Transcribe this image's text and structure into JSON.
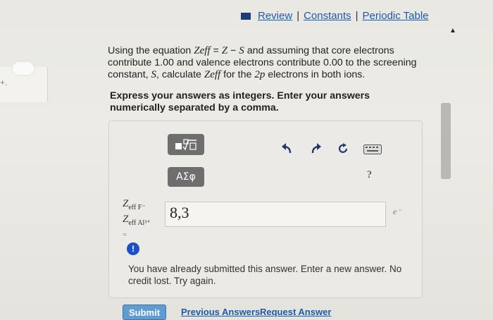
{
  "nav": {
    "review": "Review",
    "constants": "Constants",
    "periodic_table": "Periodic Table",
    "separator": "|"
  },
  "question": {
    "p1": "Using the equation ",
    "zeff": "Zeff",
    "eq": " = ",
    "z": "Z",
    "minus": " − ",
    "s": "S",
    "p2": " and assuming that core electrons contribute 1.00 and valence electrons contribute 0.00 to the screening constant, ",
    "s2": "S",
    "p3": ", calculate ",
    "zeff2": "Zeff",
    "p4": " for the ",
    "orbital": "2p",
    "p5": " electrons in both ions."
  },
  "instructions": "Express your answers as integers. Enter your answers numerically separated by a comma.",
  "toolbar": {
    "greek_label": "ΑΣφ",
    "help_label": "?"
  },
  "answer": {
    "label_line1": "Z",
    "label_sub1": "eff F⁻",
    "label_line2": "Z",
    "label_sub2": "eff Al³⁺",
    "label_eq": "=",
    "value": "8,3",
    "unit": "e⁻"
  },
  "feedback": {
    "icon": "!",
    "text": "You have already submitted this answer. Enter a new answer. No credit lost. Try again."
  },
  "actions": {
    "submit": "Submit",
    "previous_answers": "Previous Answers",
    "request_answer": "Request Answer"
  },
  "colors": {
    "link": "#1c5ba8",
    "submit_bg": "#5e9cd2",
    "alert": "#1b51c4",
    "tool_button": "#6e6e6e"
  }
}
